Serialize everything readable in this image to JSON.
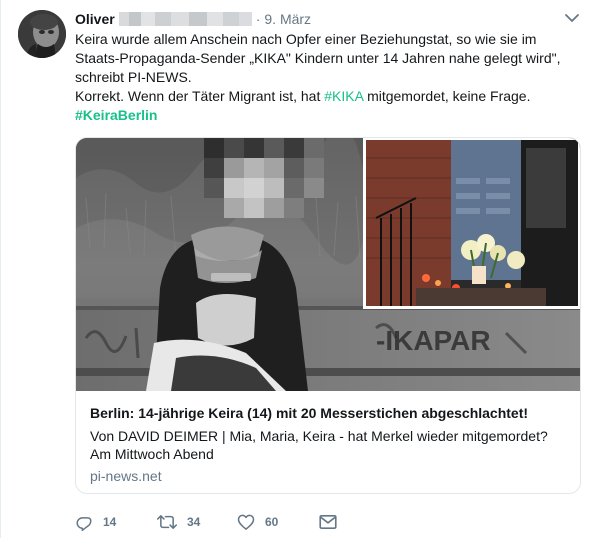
{
  "tweet": {
    "author_name": "Oliver",
    "separator": "·",
    "date": "9. März",
    "text": {
      "line1": "Keira wurde allem Anschein nach Opfer einer Beziehungstat, so wie sie im Staats-Propaganda-Sender „KIKA\" Kindern unter 14 Jahren nahe gelegt wird\", schreibt PI-NEWS.",
      "line2_before": "Korrekt. Wenn der Täter Migrant ist, hat ",
      "line2_hashtag": "#KIKA",
      "line2_after": " mitgemordet, keine Frage.",
      "hashtag_line": "#KeiraBerlin"
    }
  },
  "card": {
    "title": "Berlin: 14-jährige Keira (14) mit 20 Messerstichen abgeschlachtet!",
    "description": "Von DAVID DEIMER | Mia, Maria, Keira - hat Merkel wieder mitgemordet? Am Mittwoch Abend",
    "domain": "pi-news.net",
    "image_text": {
      "graffiti": "-IKAPAR"
    }
  },
  "actions": {
    "reply_count": "14",
    "retweet_count": "34",
    "like_count": "60"
  },
  "icons": {
    "reply": "reply-icon",
    "retweet": "retweet-icon",
    "like": "heart-icon",
    "message": "envelope-icon",
    "caret": "chevron-down-icon"
  },
  "colors": {
    "hashtag_blue": "#1da1f2",
    "hashtag_green": "#18c08a",
    "muted": "#657786",
    "text": "#14171a",
    "border": "#e1e8ed"
  }
}
